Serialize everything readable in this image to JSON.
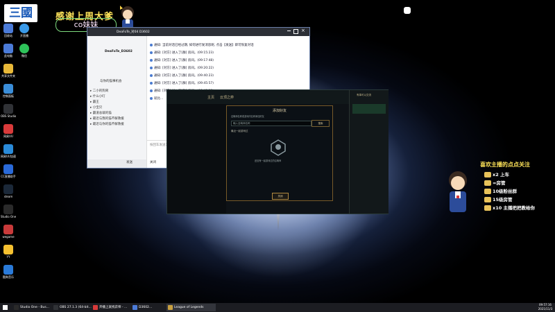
{
  "overlay": {
    "logo_text": "三國",
    "thanks_title": "感谢上周大爹",
    "thanks_name": "co妹妹"
  },
  "desktop_icons": [
    {
      "label": "回收站",
      "color": "#4b7bd8"
    },
    {
      "label": "此电脑",
      "color": "#4b7bd8"
    },
    {
      "label": "共享文件夹",
      "color": "#e8b838"
    },
    {
      "label": "控制面板",
      "color": "#3a8dd8"
    },
    {
      "label": "OBS Studio",
      "color": "#303236"
    },
    {
      "label": "网易UU",
      "color": "#d83a3a"
    },
    {
      "label": "网易UU加速器",
      "color": "#2a8ad8"
    },
    {
      "label": "CC直播助手",
      "color": "#2a6ad8"
    },
    {
      "label": "steam",
      "color": "#1b2838"
    },
    {
      "label": "Studio One 4",
      "color": "#2a2a2a"
    },
    {
      "label": "wegame",
      "color": "#c83a3a"
    },
    {
      "label": "YY",
      "color": "#f5c030"
    },
    {
      "label": "酷狗音乐",
      "color": "#2a7ad8"
    }
  ],
  "desktop_icons_col2": [
    {
      "label": "开直播",
      "color": "#3a9ae8"
    },
    {
      "label": "微信",
      "color": "#2ec25a"
    }
  ],
  "qq_window": {
    "title": "DeaFoTe_对04 D3602",
    "contact_name": "DeaFoTe_D3602",
    "group_header": "与你的猫事机会",
    "groups": [
      "二小的狗窝",
      "什么小叮",
      "霸王",
      "小宝贝",
      "霸道总裁的猫",
      "最近与我的猫不解救援",
      "最近与你的猫不解救援"
    ],
    "messages": [
      "通知: 当前对话已经过期, 如何进行发消息呢, 点击【发送】即可恢复对话",
      "通知: [对方] 进入了[群] 房间。(09:15:23)",
      "通知: [对方] 进入了[群] 房间。(09:17:48)",
      "通知: [对方] 进入了[群] 房间。(09:20:22)",
      "通知: [对方] 进入了[群] 房间。(09:40:23)",
      "通知: [对方] 进入了[群] 房间。(09:45:57)",
      "通知: [对方] 进入了[群] 房间。(09:48:12)",
      "就比..."
    ],
    "input_hint": "按回车发送消息",
    "buttons": [
      "发送",
      "关闭"
    ]
  },
  "game_client": {
    "tabs": [
      "主页",
      "云顶之弈"
    ],
    "status": "有事可以交流",
    "dialog": {
      "title": "添加好友",
      "instruction": "召唤师名称或游戏内名称添加好友",
      "search_placeholder": "输入召唤师名称",
      "search_button": "搜索",
      "recent_label": "最近一起游戏过",
      "empty_text": "还没有一起游戏过的召唤师",
      "confirm_button": "关闭"
    },
    "right_panel": {
      "title": "好友",
      "items": [
        "在线",
        "游戏中",
        "离线"
      ]
    }
  },
  "follow_overlay": {
    "title": "喜欢主播的点点关注",
    "lines": [
      "x2 上车",
      "=房管",
      "10级粉丝群",
      "15级房管",
      "x10 主播把把教给你"
    ]
  },
  "taskbar": {
    "items": [
      {
        "label": "Studio One - Bus...",
        "color": "#2a2a2a"
      },
      {
        "label": "OBS 27.1.3 (64-bit...",
        "color": "#303236"
      },
      {
        "label": "开播上就找弈师 - ...",
        "color": "#d83a3a"
      },
      {
        "label": "D3602...",
        "color": "#4b7bd8"
      },
      {
        "label": "League of Legends",
        "color": "#c8a040"
      }
    ],
    "time": "09:57:16",
    "date": "2021/11/3"
  },
  "accent_colors": {
    "gold": "#ffe45a",
    "lol_gold": "#c8aa6e",
    "qq_blue": "#4a7bd0"
  }
}
